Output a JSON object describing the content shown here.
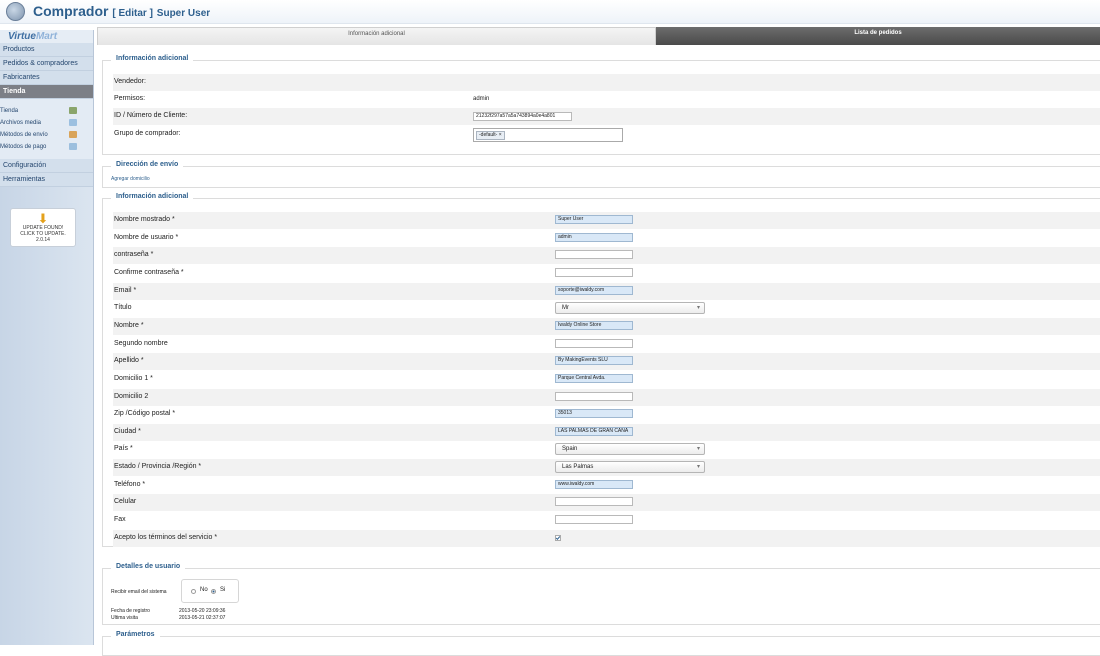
{
  "header": {
    "title": "Comprador",
    "edit_label": "[ Editar ]",
    "user": "Super User"
  },
  "sidebar": {
    "logo_main": "Virtue",
    "logo_accent": "Mart",
    "nav": [
      {
        "label": "Productos"
      },
      {
        "label": "Pedidos & compradores"
      },
      {
        "label": "Fabricantes"
      },
      {
        "label": "Tienda"
      }
    ],
    "sub": [
      {
        "label": "Tienda",
        "color": "#8aa56b"
      },
      {
        "label": "Archivos media",
        "color": "#9cc0e0"
      },
      {
        "label": "Métodos de envío",
        "color": "#d9a45a"
      },
      {
        "label": "Métodos de pago",
        "color": "#9cbfde"
      }
    ],
    "nav2": [
      {
        "label": "Configuración"
      },
      {
        "label": "Herramientas"
      }
    ],
    "update": {
      "line1": "UPDATE FOUND!",
      "line2": "CLICK TO UPDATE.",
      "version": "2.0.14"
    }
  },
  "tabs": [
    {
      "label": "Información adicional"
    },
    {
      "label": "Lista de pedidos"
    }
  ],
  "section1": {
    "legend": "Información adicional",
    "vendor_label": "Vendedor:",
    "perms_label": "Permisos:",
    "perms_value": "admin",
    "id_label": "ID / Número de Cliente:",
    "id_value": "21232f297a57a5a743894a0e4a801",
    "group_label": "Grupo de comprador:",
    "group_tag": "-default-",
    "group_tag_remove": "×"
  },
  "section2": {
    "legend": "Dirección de envío",
    "add_link": "Agregar domicilio"
  },
  "section3": {
    "legend": "Información adicional",
    "fields": [
      {
        "label": "Nombre mostrado *",
        "value": "Super User",
        "kind": "input",
        "filled": true
      },
      {
        "label": "Nombre de usuario *",
        "value": "admin",
        "kind": "input",
        "filled": true
      },
      {
        "label": "contraseña *",
        "value": "",
        "kind": "input",
        "filled": false
      },
      {
        "label": "Confirme contraseña *",
        "value": "",
        "kind": "input",
        "filled": false
      },
      {
        "label": "Email *",
        "value": "soporte@iwaldy.com",
        "kind": "input",
        "filled": true
      },
      {
        "label": "Título",
        "value": "Mr",
        "kind": "select"
      },
      {
        "label": "Nombre *",
        "value": "Iwaldy Online Store",
        "kind": "input",
        "filled": true
      },
      {
        "label": "Segundo nombre",
        "value": "",
        "kind": "input",
        "filled": false
      },
      {
        "label": "Apellido *",
        "value": "By MakingEvents SLU",
        "kind": "input",
        "filled": true
      },
      {
        "label": "Domicilio 1 *",
        "value": "Parque Central Avda.",
        "kind": "input",
        "filled": true
      },
      {
        "label": "Domicilio 2",
        "value": "",
        "kind": "input",
        "filled": false
      },
      {
        "label": "Zip /Código postal *",
        "value": "35013",
        "kind": "input",
        "filled": true
      },
      {
        "label": "Ciudad *",
        "value": "LAS PALMAS DE GRAN CANA",
        "kind": "input",
        "filled": true
      },
      {
        "label": "País *",
        "value": "Spain",
        "kind": "select"
      },
      {
        "label": "Estado / Provincia /Región *",
        "value": "Las Palmas",
        "kind": "select"
      },
      {
        "label": "Teléfono *",
        "value": "www.iwaldy.com",
        "kind": "input",
        "filled": true
      },
      {
        "label": "Celular",
        "value": "",
        "kind": "input",
        "filled": false
      },
      {
        "label": "Fax",
        "value": "",
        "kind": "input",
        "filled": false
      },
      {
        "label": "Acepto los términos del servicio *",
        "value": "",
        "kind": "checkbox",
        "checked": true
      }
    ]
  },
  "section4": {
    "legend": "Detalles de usuario",
    "email_label": "Recibir email del sistema",
    "no_label": "No",
    "si_label": "Si",
    "selected": "Si",
    "reg_label": "Fecha de registro",
    "reg_value": "2013-05-20 23:09:36",
    "visit_label": "Ultima visita",
    "visit_value": "2013-05-21 02:37:07"
  },
  "section5": {
    "legend": "Parámetros"
  }
}
